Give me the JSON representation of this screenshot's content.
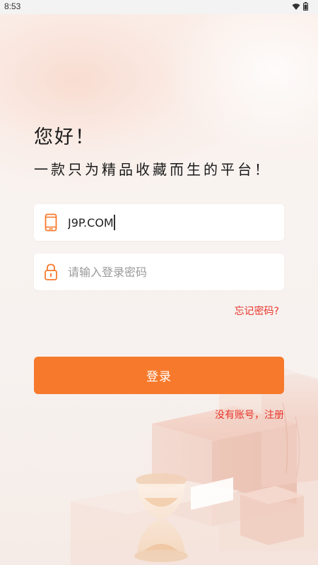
{
  "status_bar": {
    "time": "8:53",
    "icons": [
      "wifi-icon",
      "battery-icon"
    ]
  },
  "greeting": {
    "title": "您好！",
    "subtitle": "一款只为精品收藏而生的平台！"
  },
  "form": {
    "phone": {
      "icon": "phone-icon",
      "value": "J9P.COM"
    },
    "password": {
      "icon": "lock-icon",
      "placeholder": "请输入登录密码",
      "value": ""
    },
    "forgot_password": "忘记密码?",
    "login_button": "登录",
    "register_link": "没有账号，注册"
  },
  "colors": {
    "accent": "#f77a2c",
    "link": "#e8342a",
    "background": "#f7f2ef"
  }
}
